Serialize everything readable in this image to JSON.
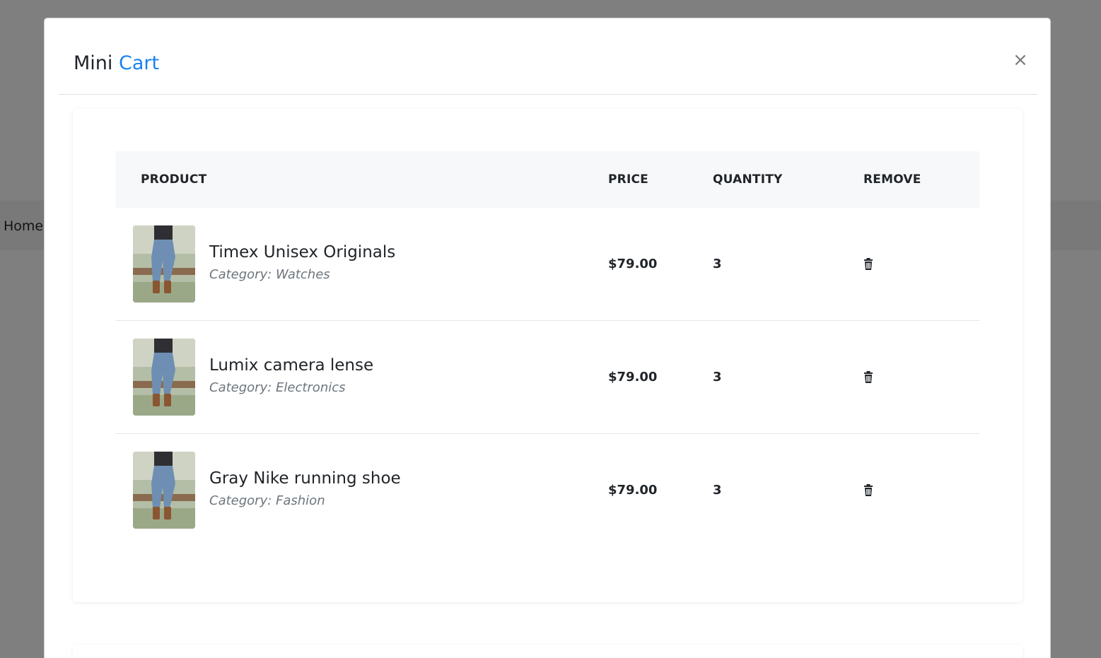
{
  "page": {
    "nav_home_label": "Home"
  },
  "modal": {
    "title_part1": "Mini",
    "title_part2": "Cart",
    "close_label": "×",
    "accent_color": "#1a82f0"
  },
  "table": {
    "headers": {
      "product": "PRODUCT",
      "price": "PRICE",
      "quantity": "QUANTITY",
      "remove": "REMOVE"
    },
    "rows": [
      {
        "name": "Timex Unisex Originals",
        "category": "Category: Watches",
        "price": "$79.00",
        "quantity": "3",
        "thumbnail_icon": "product-photo",
        "remove_icon": "trash-icon"
      },
      {
        "name": "Lumix camera lense",
        "category": "Category: Electronics",
        "price": "$79.00",
        "quantity": "3",
        "thumbnail_icon": "product-photo",
        "remove_icon": "trash-icon"
      },
      {
        "name": "Gray Nike running shoe",
        "category": "Category: Fashion",
        "price": "$79.00",
        "quantity": "3",
        "thumbnail_icon": "product-photo",
        "remove_icon": "trash-icon"
      }
    ]
  }
}
